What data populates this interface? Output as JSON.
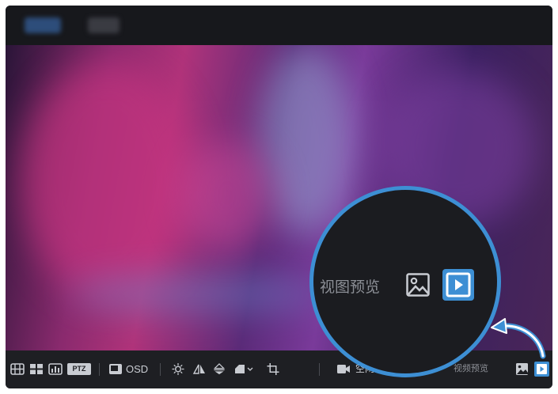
{
  "toolbar": {
    "ptz_label": "PTZ",
    "osd_label": "OSD",
    "record_label": "空闲",
    "view_preview_label": "视频预览"
  },
  "magnifier": {
    "view_preview_label": "视图预览"
  },
  "colors": {
    "accent": "#3d8fd4",
    "toolbar_bg": "#1e1f23",
    "icon": "#c9ccd2"
  }
}
